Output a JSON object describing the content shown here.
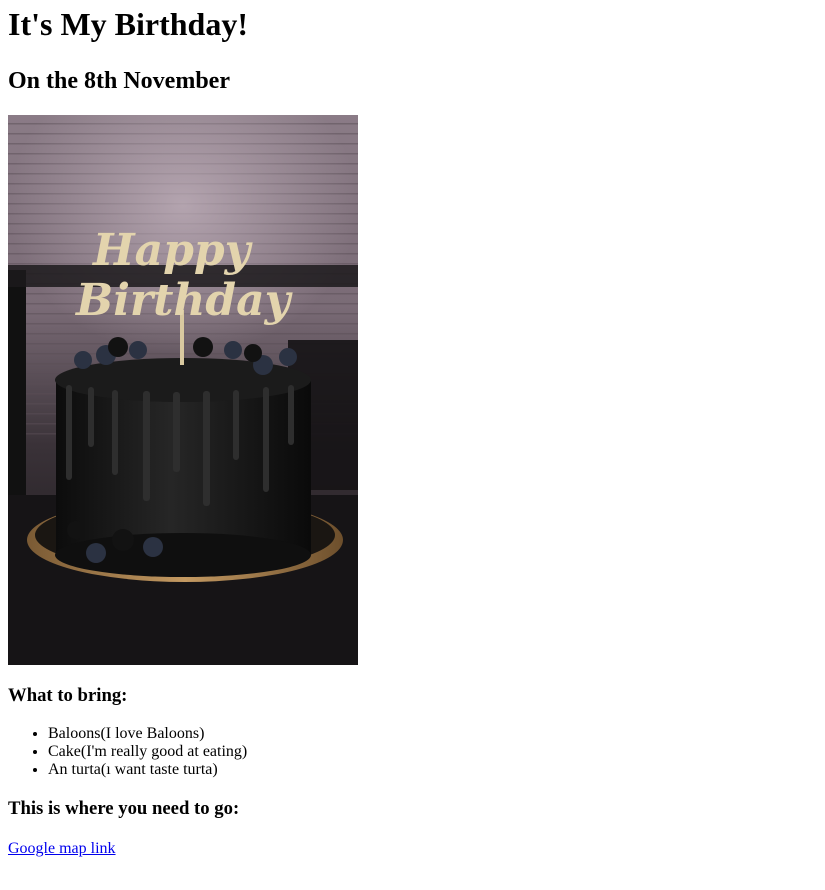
{
  "title": "It's My Birthday!",
  "subtitle": "On the 8th November",
  "image": {
    "alt": "birthday cake photo",
    "topper_text": [
      "Happy",
      "Birthday"
    ]
  },
  "bring": {
    "heading": "What to bring:",
    "items": [
      "Baloons(I love Baloons)",
      "Cake(I'm really good at eating)",
      "An turta(ı want taste turta)"
    ]
  },
  "location": {
    "heading": "This is where you need to go:",
    "link_text": "Google map link"
  }
}
